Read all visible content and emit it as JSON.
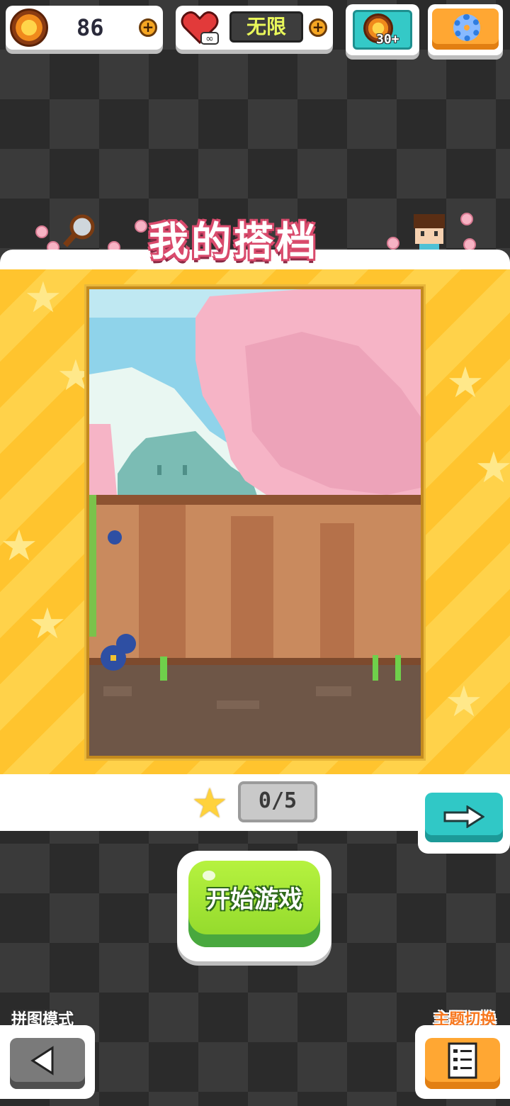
{
  "top_bar": {
    "coins": {
      "value": "86",
      "icon": "coin-icon",
      "add_icon": "plus-icon"
    },
    "lives": {
      "value": "无限",
      "icon": "heart-infinity-icon",
      "add_icon": "plus-icon"
    },
    "video_reward": {
      "label": "30+",
      "icon": "video-coin-icon"
    },
    "settings": {
      "icon": "gear-icon"
    }
  },
  "header": {
    "title": "我的搭档"
  },
  "puzzle": {
    "scene": "pixel-art garden with cherry blossom tree and wooden fence",
    "progress": "0/5",
    "star_icon": "star-icon",
    "next_icon": "arrow-right-icon"
  },
  "actions": {
    "start_label": "开始游戏",
    "left_mode_label": "拼图模式",
    "right_mode_label": "主题切换",
    "left_icon": "back-triangle-icon",
    "right_icon": "list-icon"
  },
  "colors": {
    "accent_yellow": "#ffc42e",
    "start_green": "#9be033",
    "teal": "#30c8c6",
    "orange": "#ffa733",
    "title_pink": "#d94a6c"
  }
}
